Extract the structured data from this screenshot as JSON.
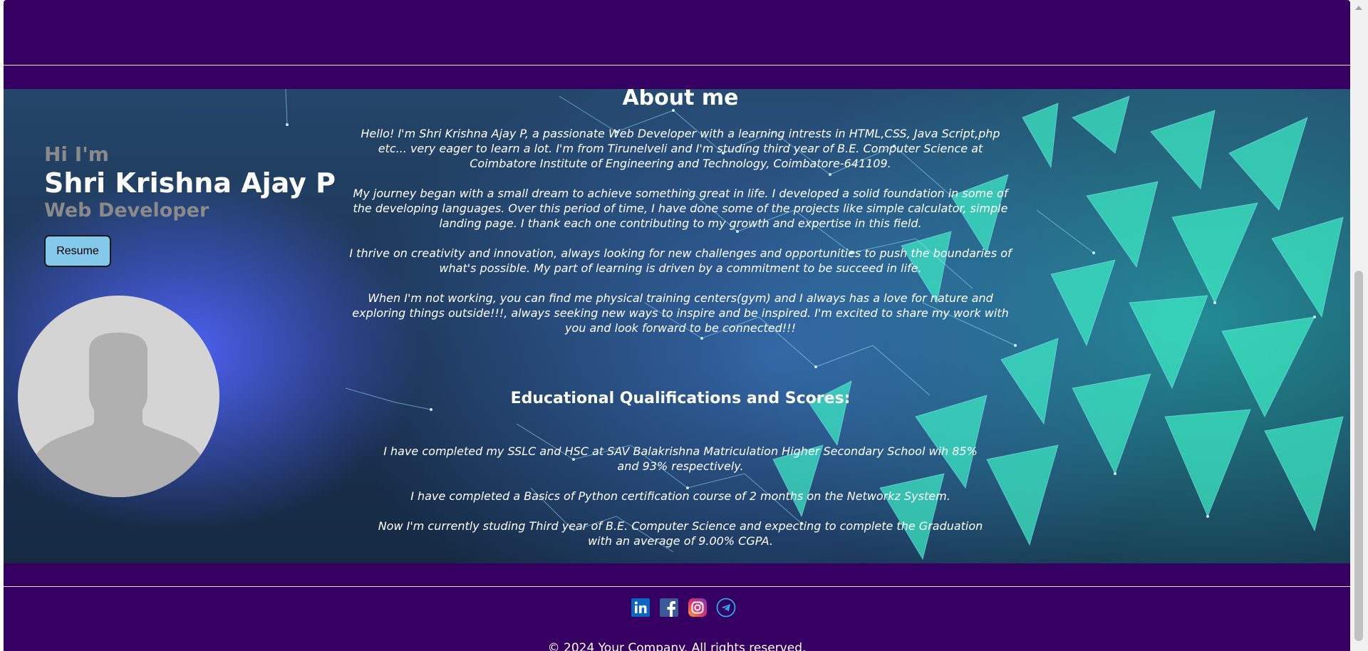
{
  "intro": {
    "greeting": "Hi I'm",
    "name": "Shri Krishna Ajay P",
    "role": "Web Developer",
    "resume_label": "Resume"
  },
  "about": {
    "title": "About me",
    "paragraphs": [
      "Hello! I'm Shri Krishna Ajay P, a passionate Web Developer with a learning intrests in HTML,CSS, Java Script,php etc... very eager to learn a lot. I'm from Tirunelveli and I'm studing third year of B.E. Computer Science at Coimbatore Institute of Engineering and Technology, Coimbatore-641109.",
      "My journey began with a small dream to achieve something great in life. I developed a solid foundation in some of the developing languages. Over this period of time, I have done some of the projects like simple calculator, simple landing page. I thank each one contributing to my growth and expertise in this field.",
      "I thrive on creativity and innovation, always looking for new challenges and opportunities to push the boundaries of what's possible. My part of learning is driven by a commitment to be succeed in life.",
      "When I'm not working, you can find me physical training centers(gym) and I always has a love for nature and exploring things outside!!!, always seeking new ways to inspire and be inspired. I'm excited to share my work with you and look forward to be connected!!!"
    ]
  },
  "education": {
    "title": "Educational Qualifications and Scores:",
    "items": [
      "I have completed my SSLC and HSC at SAV Balakrishna Matriculation Higher Secondary School wih 85% and 93% respectively.",
      "I have completed a Basics of Python certification course of 2 months on the Networkz System.",
      "Now I'm currently studing Third year of B.E. Computer Science and expecting to complete the Graduation with an average of 9.00% CGPA."
    ]
  },
  "socials": [
    {
      "icon": "linkedin-icon",
      "color": "#0a66c2"
    },
    {
      "icon": "facebook-icon",
      "color": "#3b5998"
    },
    {
      "icon": "instagram-icon",
      "color": "#e1306c"
    },
    {
      "icon": "telegram-icon",
      "color": "#2aabee"
    }
  ],
  "footer": {
    "copyright": "© 2024 Your Company. All rights reserved."
  },
  "colors": {
    "page_background": "#360062",
    "resume_button": "#84c8ec",
    "name_text": "#ffffff",
    "muted_text": "#8a8a8a"
  }
}
